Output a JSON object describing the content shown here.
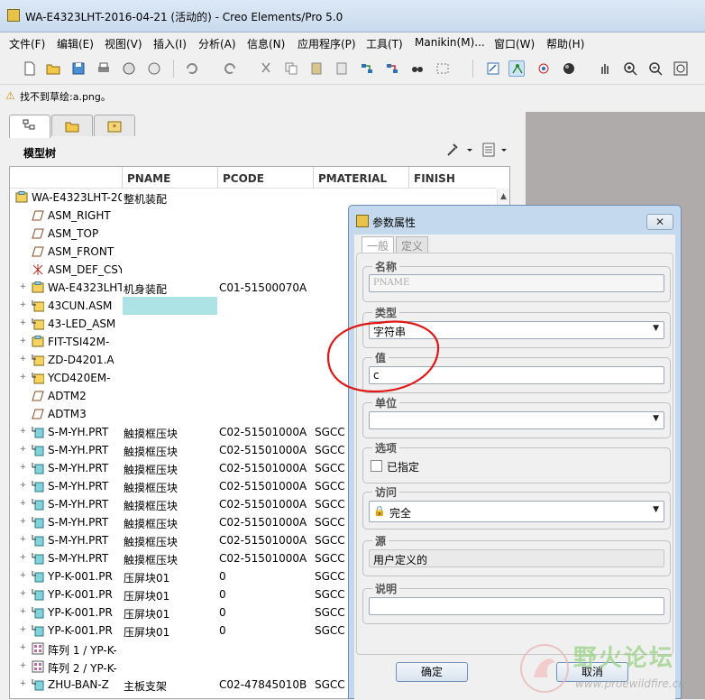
{
  "window": {
    "title": "WA-E4323LHT-2016-04-21 (活动的) - Creo Elements/Pro 5.0"
  },
  "menu": [
    {
      "label": "文件(F)"
    },
    {
      "label": "编辑(E)"
    },
    {
      "label": "视图(V)"
    },
    {
      "label": "插入(I)"
    },
    {
      "label": "分析(A)"
    },
    {
      "label": "信息(N)"
    },
    {
      "label": "应用程序(P)"
    },
    {
      "label": "工具(T)"
    },
    {
      "label": "Manikin(M)..."
    },
    {
      "label": "窗口(W)"
    },
    {
      "label": "帮助(H)"
    }
  ],
  "message": {
    "text": "找不到草绘:a.png。"
  },
  "model_tree": {
    "title": "模型树",
    "columns": [
      "PNAME",
      "PCODE",
      "PMATERIAL",
      "FINISH"
    ],
    "rows": [
      {
        "name": "WA-E4323LHT-20",
        "pname": "整机装配",
        "pcode": "",
        "pmat": "",
        "icon": "assembly",
        "indent": 0,
        "exp": ""
      },
      {
        "name": "ASM_RIGHT",
        "pname": "",
        "pcode": "",
        "pmat": "",
        "icon": "datum-plane",
        "indent": 1,
        "exp": ""
      },
      {
        "name": "ASM_TOP",
        "pname": "",
        "pcode": "",
        "pmat": "",
        "icon": "datum-plane",
        "indent": 1,
        "exp": ""
      },
      {
        "name": "ASM_FRONT",
        "pname": "",
        "pcode": "",
        "pmat": "",
        "icon": "datum-plane",
        "indent": 1,
        "exp": ""
      },
      {
        "name": "ASM_DEF_CSY",
        "pname": "",
        "pcode": "",
        "pmat": "",
        "icon": "csys",
        "indent": 1,
        "exp": ""
      },
      {
        "name": "WA-E4323LHT",
        "pname": "机身装配",
        "pcode": "C01-51500070A",
        "pmat": "",
        "icon": "assembly",
        "indent": 1,
        "exp": "+"
      },
      {
        "name": "43CUN.ASM",
        "pname": "",
        "pcode": "",
        "pmat": "",
        "icon": "assembly-link",
        "indent": 1,
        "exp": "+",
        "highlight": true
      },
      {
        "name": "43-LED_ASM",
        "pname": "",
        "pcode": "",
        "pmat": "",
        "icon": "assembly-link",
        "indent": 1,
        "exp": "+"
      },
      {
        "name": "FIT-TSI42M-",
        "pname": "",
        "pcode": "",
        "pmat": "",
        "icon": "assembly",
        "indent": 1,
        "exp": "+"
      },
      {
        "name": "ZD-D4201.A",
        "pname": "",
        "pcode": "",
        "pmat": "",
        "icon": "assembly-link",
        "indent": 1,
        "exp": "+"
      },
      {
        "name": "YCD420EM-",
        "pname": "",
        "pcode": "",
        "pmat": "",
        "icon": "assembly-link",
        "indent": 1,
        "exp": "+"
      },
      {
        "name": "ADTM2",
        "pname": "",
        "pcode": "",
        "pmat": "",
        "icon": "datum-plane",
        "indent": 1,
        "exp": ""
      },
      {
        "name": "ADTM3",
        "pname": "",
        "pcode": "",
        "pmat": "",
        "icon": "datum-plane",
        "indent": 1,
        "exp": ""
      },
      {
        "name": "S-M-YH.PRT",
        "pname": "触摸框压块",
        "pcode": "C02-51501000A",
        "pmat": "SGCC",
        "icon": "part-link",
        "indent": 1,
        "exp": "+"
      },
      {
        "name": "S-M-YH.PRT",
        "pname": "触摸框压块",
        "pcode": "C02-51501000A",
        "pmat": "SGCC",
        "icon": "part-link",
        "indent": 1,
        "exp": "+"
      },
      {
        "name": "S-M-YH.PRT",
        "pname": "触摸框压块",
        "pcode": "C02-51501000A",
        "pmat": "SGCC",
        "icon": "part-link",
        "indent": 1,
        "exp": "+"
      },
      {
        "name": "S-M-YH.PRT",
        "pname": "触摸框压块",
        "pcode": "C02-51501000A",
        "pmat": "SGCC",
        "icon": "part-link",
        "indent": 1,
        "exp": "+"
      },
      {
        "name": "S-M-YH.PRT",
        "pname": "触摸框压块",
        "pcode": "C02-51501000A",
        "pmat": "SGCC",
        "icon": "part-link",
        "indent": 1,
        "exp": "+"
      },
      {
        "name": "S-M-YH.PRT",
        "pname": "触摸框压块",
        "pcode": "C02-51501000A",
        "pmat": "SGCC",
        "icon": "part-link",
        "indent": 1,
        "exp": "+"
      },
      {
        "name": "S-M-YH.PRT",
        "pname": "触摸框压块",
        "pcode": "C02-51501000A",
        "pmat": "SGCC",
        "icon": "part-link",
        "indent": 1,
        "exp": "+"
      },
      {
        "name": "S-M-YH.PRT",
        "pname": "触摸框压块",
        "pcode": "C02-51501000A",
        "pmat": "SGCC",
        "icon": "part-link",
        "indent": 1,
        "exp": "+"
      },
      {
        "name": "YP-K-001.PR",
        "pname": "压屏块01",
        "pcode": "0",
        "pmat": "SGCC",
        "icon": "part-link",
        "indent": 1,
        "exp": "+"
      },
      {
        "name": "YP-K-001.PR",
        "pname": "压屏块01",
        "pcode": "0",
        "pmat": "SGCC",
        "icon": "part-link",
        "indent": 1,
        "exp": "+"
      },
      {
        "name": "YP-K-001.PR",
        "pname": "压屏块01",
        "pcode": "0",
        "pmat": "SGCC",
        "icon": "part-link",
        "indent": 1,
        "exp": "+"
      },
      {
        "name": "YP-K-001.PR",
        "pname": "压屏块01",
        "pcode": "0",
        "pmat": "SGCC",
        "icon": "part-link",
        "indent": 1,
        "exp": "+"
      },
      {
        "name": "阵列 1 / YP-K-",
        "pname": "",
        "pcode": "",
        "pmat": "",
        "icon": "pattern",
        "indent": 1,
        "exp": "+"
      },
      {
        "name": "阵列 2 / YP-K-",
        "pname": "",
        "pcode": "",
        "pmat": "",
        "icon": "pattern",
        "indent": 1,
        "exp": "+"
      },
      {
        "name": "ZHU-BAN-Z",
        "pname": "主板支架",
        "pcode": "C02-47845010B",
        "pmat": "SGCC",
        "icon": "part-link",
        "indent": 1,
        "exp": "+"
      }
    ]
  },
  "dialog": {
    "title": "参数属性",
    "close": "✕",
    "tabs": [
      "一般",
      "定义"
    ],
    "name_label": "名称",
    "name_value": "PNAME",
    "type_label": "类型",
    "type_value": "字符串",
    "value_label": "值",
    "value_value": "c",
    "unit_label": "单位",
    "unit_value": "",
    "options_label": "选项",
    "specified_label": "已指定",
    "access_label": "访问",
    "access_value": "完全",
    "source_label": "源",
    "source_value": "用户定义的",
    "desc_label": "说明",
    "desc_value": "",
    "ok": "确定",
    "cancel": "取消"
  },
  "watermark": {
    "title": "野火论坛",
    "url": "www.proewildfire.cn"
  },
  "colors": {
    "highlight": "#aee3e6",
    "annotation": "#e01818",
    "dialog_frame": "#c5d9ee"
  }
}
